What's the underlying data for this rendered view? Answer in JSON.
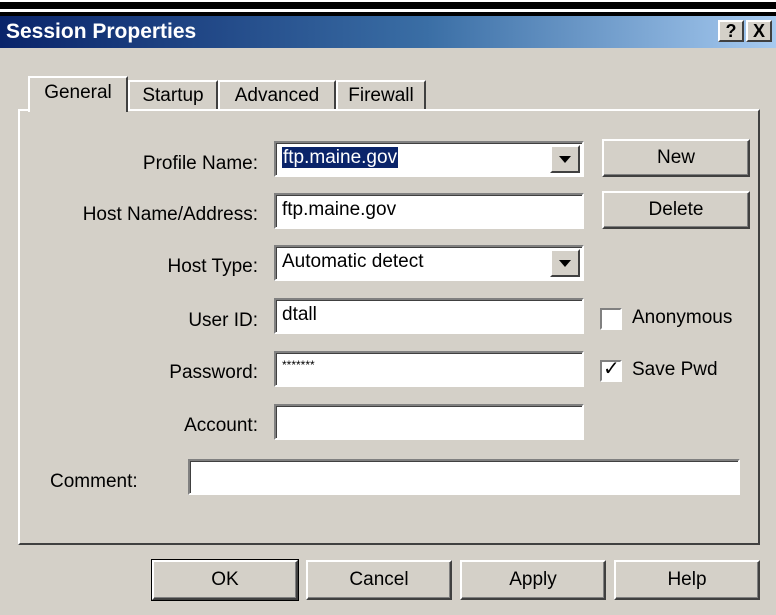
{
  "window": {
    "title": "Session Properties",
    "help_button": "?",
    "close_button": "X"
  },
  "tabs": [
    {
      "label": "General",
      "active": true
    },
    {
      "label": "Startup",
      "active": false
    },
    {
      "label": "Advanced",
      "active": false
    },
    {
      "label": "Firewall",
      "active": false
    }
  ],
  "general": {
    "profile_name": {
      "label": "Profile Name:",
      "value": "ftp.maine.gov"
    },
    "host_name": {
      "label": "Host Name/Address:",
      "value": "ftp.maine.gov"
    },
    "host_type": {
      "label": "Host Type:",
      "value": "Automatic detect"
    },
    "user_id": {
      "label": "User ID:",
      "value": "dtall"
    },
    "password": {
      "label": "Password:",
      "value": "*******"
    },
    "account": {
      "label": "Account:",
      "value": ""
    },
    "comment": {
      "label": "Comment:",
      "value": ""
    },
    "new_button": "New",
    "delete_button": "Delete",
    "anonymous": {
      "label": "Anonymous",
      "checked": false
    },
    "save_pwd": {
      "label": "Save Pwd",
      "checked": true
    }
  },
  "footer": {
    "ok": "OK",
    "cancel": "Cancel",
    "apply": "Apply",
    "help": "Help"
  }
}
